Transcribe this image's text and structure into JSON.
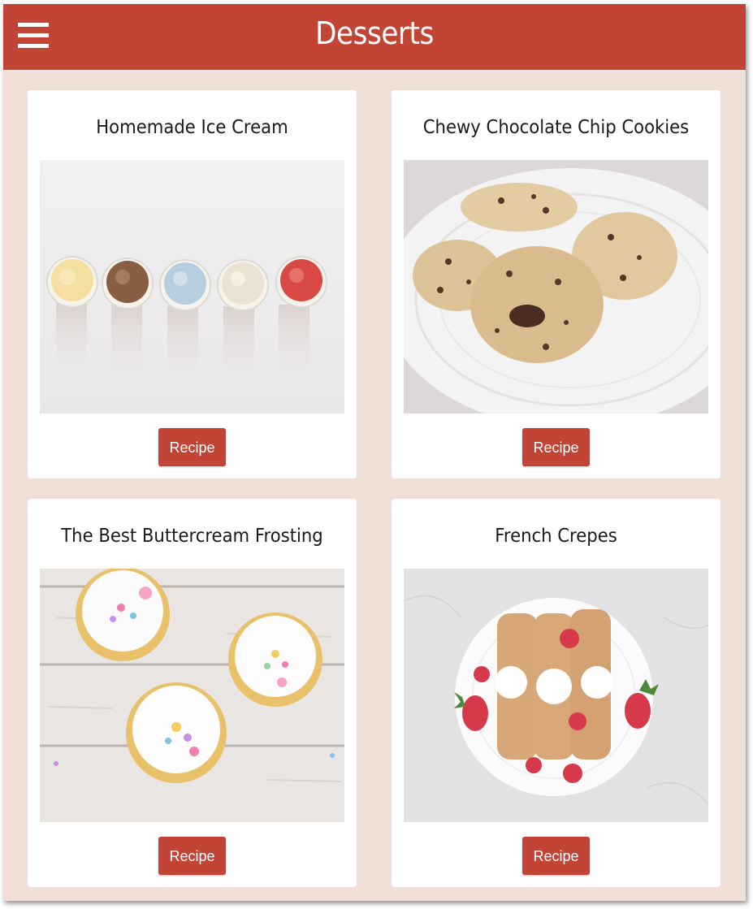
{
  "header": {
    "title": "Desserts",
    "menu_icon": "hamburger-menu-icon"
  },
  "colors": {
    "brand": "#c24435",
    "background": "#efdfd7",
    "card": "#ffffff"
  },
  "cards": [
    {
      "title": "Homemade Ice Cream",
      "button_label": "Recipe",
      "image": "ice-cream-scoops-photo"
    },
    {
      "title": "Chewy Chocolate Chip Cookies",
      "button_label": "Recipe",
      "image": "chocolate-chip-cookies-photo"
    },
    {
      "title": "The Best Buttercream Frosting",
      "button_label": "Recipe",
      "image": "buttercream-cupcakes-photo"
    },
    {
      "title": "French Crepes",
      "button_label": "Recipe",
      "image": "french-crepes-photo"
    }
  ]
}
